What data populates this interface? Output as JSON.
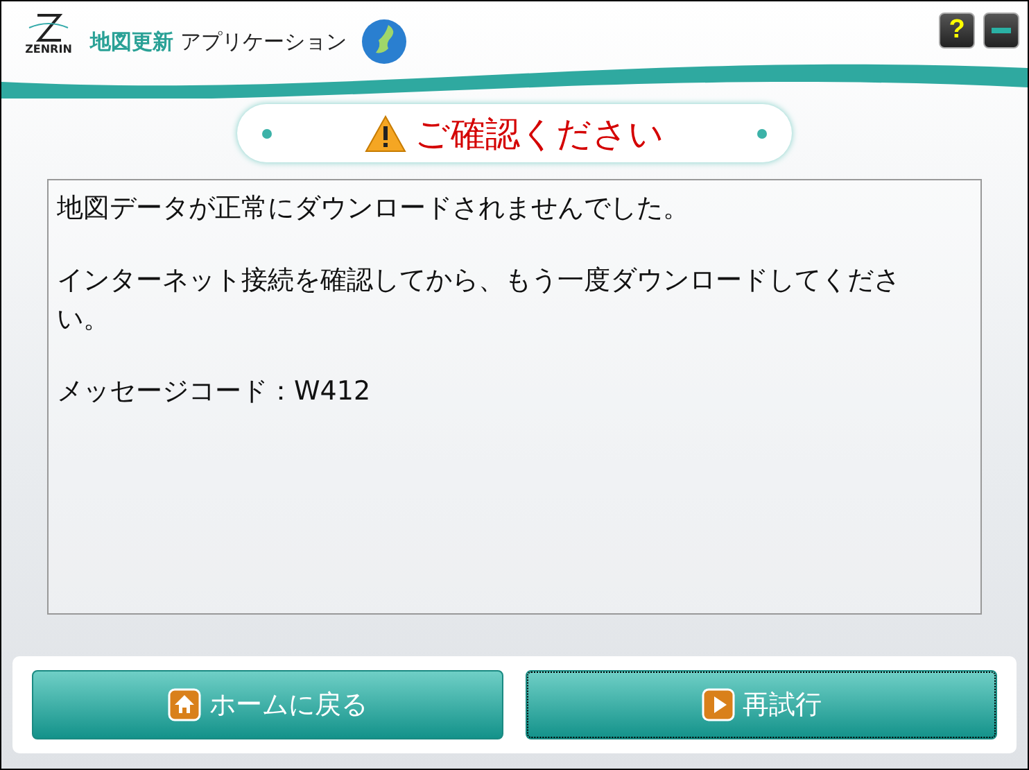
{
  "header": {
    "logo_text": "ZENRIN",
    "title_accent": "地図更新",
    "title_rest": "アプリケーション",
    "tools": [
      {
        "kind": "help",
        "label": "?"
      },
      {
        "kind": "minimize"
      }
    ]
  },
  "notice": {
    "title": "ご確認ください"
  },
  "message": {
    "paragraphs": [
      "地図データが正常にダウンロードされませんでした。",
      "インターネット接続を確認してから、もう一度ダウンロードしてください。",
      "メッセージコード：W412"
    ]
  },
  "buttons": [
    {
      "label": "ホームに戻る",
      "kind": "home",
      "focused": false
    },
    {
      "label": "再試行",
      "kind": "play",
      "focused": true
    }
  ]
}
